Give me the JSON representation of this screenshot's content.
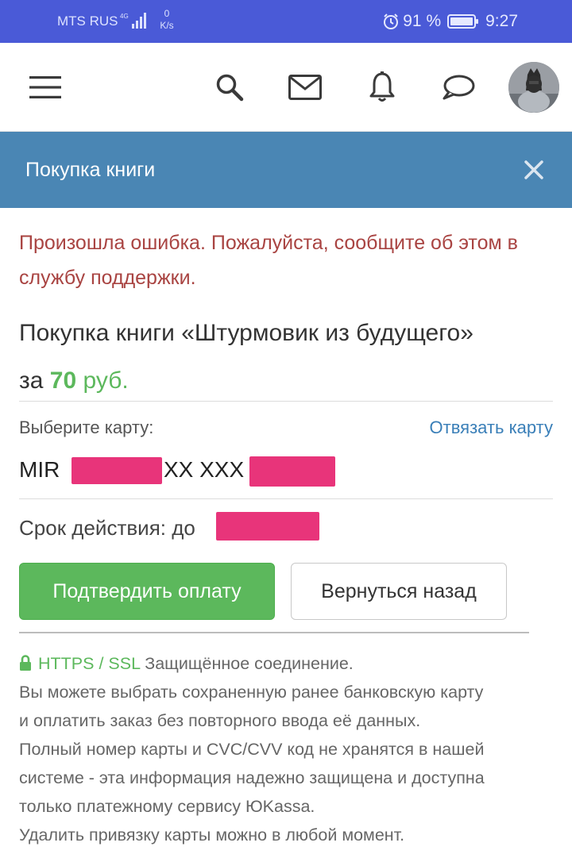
{
  "status_bar": {
    "carrier": "MTS RUS",
    "network_type": "4G",
    "speed_value": "0",
    "speed_unit": "K/s",
    "battery": "91 %",
    "time": "9:27",
    "bg_color": "#4a5ad7"
  },
  "header": {
    "icons": [
      "menu-icon",
      "search-icon",
      "mail-icon",
      "bell-icon",
      "chat-icon"
    ]
  },
  "modal": {
    "title": "Покупка книги",
    "bar_color": "#4a86b4"
  },
  "content": {
    "error": "Произошла ошибка. Пожалуйста, сообщите об этом в службу поддержки.",
    "purchase_prefix": "Покупка книги «Штурмовик из будущего»",
    "purchase_for": "за",
    "price_amount": "70",
    "price_currency": "руб.",
    "choose_card_label": "Выберите карту:",
    "unlink_card": "Отвязать карту",
    "card_prefix": "MIR",
    "card_middle": "XX XXX",
    "expiry_label": "Срок действия: до",
    "confirm_button": "Подтвердить оплату",
    "back_button": "Вернуться назад",
    "accent_color": "#5cb85c",
    "error_color": "#a94442"
  },
  "info": {
    "ssl_label": "HTTPS / SSL",
    "secure_text": "Защищённое соединение.",
    "lines": [
      "Вы можете выбрать сохраненную ранее банковскую карту",
      "и оплатить заказ без повторного ввода её данных.",
      "Полный номер карты и CVC/CVV код не хранятся в нашей",
      "системе - эта информация надежно защищена и доступна",
      "только платежному сервису ЮKassa.",
      "Удалить привязку карты можно в любой момент."
    ]
  }
}
